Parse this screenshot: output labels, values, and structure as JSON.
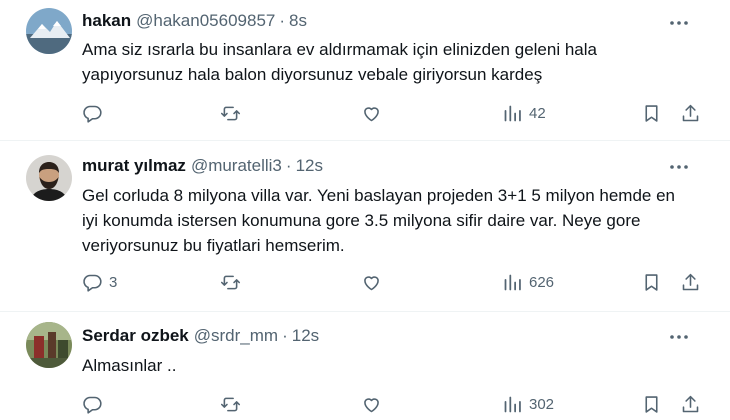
{
  "tweets": [
    {
      "name": "hakan",
      "handle": "@hakan05609857",
      "separator": "·",
      "time": "8s",
      "text": "Ama siz ısrarla bu insanlara ev aldırmamak için elinizden geleni hala yapıyorsunuz hala balon diyorsunuz vebale giriyorsun kardeş",
      "replies": "",
      "views": "42",
      "avatar": "avatar-mountain"
    },
    {
      "name": "murat yılmaz",
      "handle": "@muratelli3",
      "separator": "·",
      "time": "12s",
      "text": "Gel corluda 8 milyona villa var. Yeni baslayan projeden 3+1 5 milyon hemde en iyi konumda istersen konumuna gore 3.5 milyona sifir daire var. Neye gore veriyorsunuz bu fiyatlari hemserim.",
      "replies": "3",
      "views": "626",
      "avatar": "avatar-man-beard"
    },
    {
      "name": "Serdar ozbek",
      "handle": "@srdr_mm",
      "separator": "·",
      "time": "12s",
      "text": "Almasınlar ..",
      "replies": "",
      "views": "302",
      "avatar": "avatar-photo"
    }
  ],
  "colors": {
    "text": "#0f1419",
    "secondary": "#536471",
    "divider": "#eff3f4"
  },
  "icons": [
    "reply-icon",
    "retweet-icon",
    "like-icon",
    "views-icon",
    "bookmark-icon",
    "share-icon",
    "more-icon"
  ]
}
